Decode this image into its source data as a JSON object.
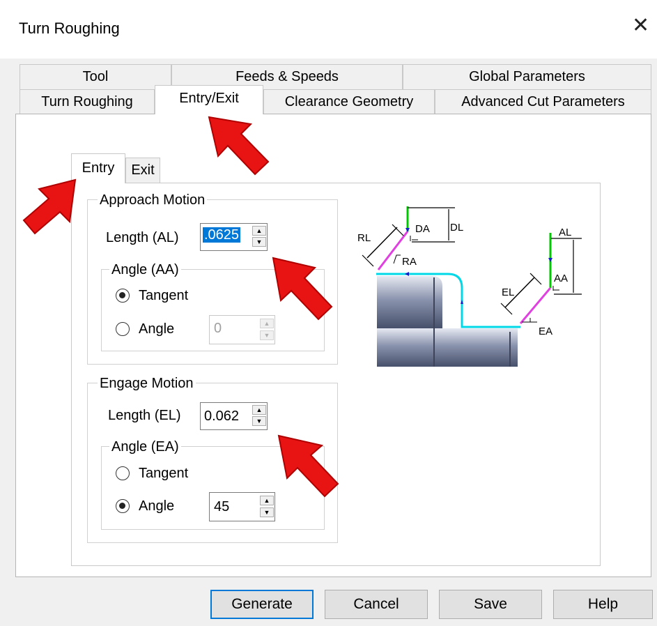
{
  "window": {
    "title": "Turn Roughing",
    "close_glyph": "✕"
  },
  "tabs_row1": [
    "Tool",
    "Feeds & Speeds",
    "Global Parameters"
  ],
  "tabs_row2": [
    "Turn Roughing",
    "Entry/Exit",
    "Clearance Geometry",
    "Advanced Cut Parameters"
  ],
  "subtabs": [
    "Entry",
    "Exit"
  ],
  "approach": {
    "title": "Approach Motion",
    "length_label": "Length (AL)",
    "length_value": ".0625",
    "angle_group": "Angle (AA)",
    "tangent_label": "Tangent",
    "angle_label": "Angle",
    "angle_value": "0",
    "selected": "Tangent"
  },
  "engage": {
    "title": "Engage Motion",
    "length_label": "Length (EL)",
    "length_value": "0.062",
    "angle_group": "Angle (EA)",
    "tangent_label": "Tangent",
    "angle_label": "Angle",
    "angle_value": "45",
    "selected": "Angle"
  },
  "diagram_labels": {
    "rl": "RL",
    "da": "DA",
    "dl": "DL",
    "ra": "RA",
    "al": "AL",
    "aa": "AA",
    "el": "EL",
    "ea": "EA"
  },
  "buttons": [
    "Generate",
    "Cancel",
    "Save",
    "Help"
  ],
  "colors": {
    "accent": "#0078d7",
    "arrow": "#e81414",
    "path": "#00d8e8",
    "green": "#00c800",
    "magenta": "#e040e0"
  }
}
